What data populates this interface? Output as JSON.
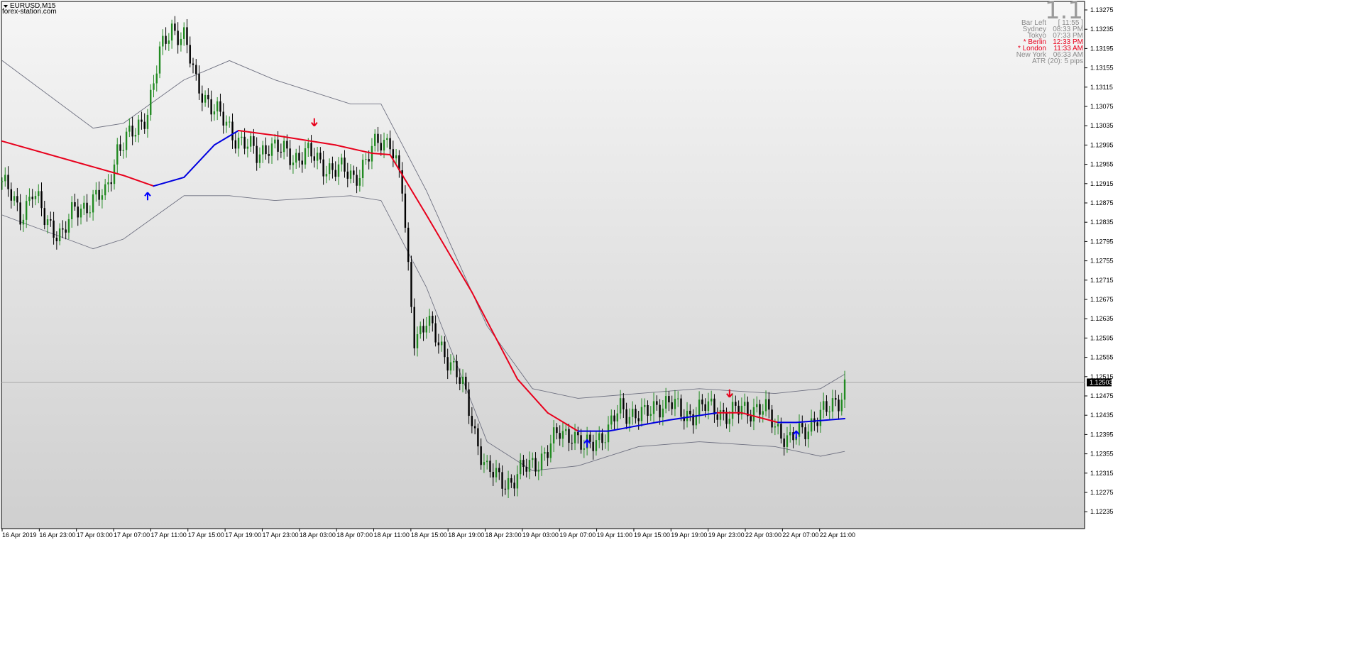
{
  "header": {
    "symbol": "EURUSD,M15",
    "website": "forex-station.com"
  },
  "info_panel": {
    "big_value": "1.1",
    "bar_left_label": "Bar Left",
    "bar_left_value": "[ 11:55 ]",
    "sessions": [
      {
        "label": "Sydney",
        "time": "08:33 PM",
        "active": false
      },
      {
        "label": "Tokyo",
        "time": "07:33 PM",
        "active": false
      },
      {
        "label": "* Berlin",
        "time": "12:33 PM",
        "active": true
      },
      {
        "label": "* London",
        "time": "11:33 AM",
        "active": true
      },
      {
        "label": "New York",
        "time": "06:33 AM",
        "active": false
      }
    ],
    "atr": "ATR (20): 5 pips"
  },
  "colors": {
    "up_candle": "#228b22",
    "down_candle": "#000000",
    "ma_down": "#e8001c",
    "ma_up": "#0000e0",
    "bands": "#6e7080",
    "arrow_up": "#0000ff",
    "arrow_down": "#e8001c",
    "price_label_bg": "#000000"
  },
  "chart_data": {
    "type": "candlestick",
    "symbol": "EURUSD",
    "timeframe": "M15",
    "y_ticks": [
      "1.13275",
      "1.13235",
      "1.13195",
      "1.13155",
      "1.13115",
      "1.13075",
      "1.13035",
      "1.12995",
      "1.12955",
      "1.12915",
      "1.12875",
      "1.12835",
      "1.12795",
      "1.12755",
      "1.12715",
      "1.12675",
      "1.12635",
      "1.12595",
      "1.12555",
      "1.12515",
      "1.12475",
      "1.12435",
      "1.12395",
      "1.12355",
      "1.12315",
      "1.12275",
      "1.12235"
    ],
    "ylim": [
      1.12225,
      1.13289
    ],
    "x_ticks": [
      "16 Apr 2019",
      "16 Apr 23:00",
      "17 Apr 03:00",
      "17 Apr 07:00",
      "17 Apr 11:00",
      "17 Apr 15:00",
      "17 Apr 19:00",
      "17 Apr 23:00",
      "18 Apr 03:00",
      "18 Apr 07:00",
      "18 Apr 11:00",
      "18 Apr 15:00",
      "18 Apr 19:00",
      "18 Apr 23:00",
      "19 Apr 03:00",
      "19 Apr 07:00",
      "19 Apr 11:00",
      "19 Apr 15:00",
      "19 Apr 19:00",
      "19 Apr 23:00",
      "22 Apr 03:00",
      "22 Apr 07:00",
      "22 Apr 11:00"
    ],
    "current_price": "1.12503",
    "price_path": [
      [
        0,
        1.1292
      ],
      [
        6,
        1.1285
      ],
      [
        10,
        1.129
      ],
      [
        14,
        1.1284
      ],
      [
        20,
        1.1281
      ],
      [
        24,
        1.1286
      ],
      [
        30,
        1.1288
      ],
      [
        34,
        1.1289
      ],
      [
        38,
        1.1299
      ],
      [
        44,
        1.1302
      ],
      [
        48,
        1.1307
      ],
      [
        52,
        1.1318
      ],
      [
        56,
        1.1324
      ],
      [
        60,
        1.1322
      ],
      [
        64,
        1.1312
      ],
      [
        68,
        1.1309
      ],
      [
        72,
        1.1305
      ],
      [
        76,
        1.1302
      ],
      [
        80,
        1.13
      ],
      [
        84,
        1.1297
      ],
      [
        88,
        1.13
      ],
      [
        92,
        1.1298
      ],
      [
        96,
        1.1297
      ],
      [
        100,
        1.1298
      ],
      [
        104,
        1.1296
      ],
      [
        108,
        1.1295
      ],
      [
        112,
        1.1294
      ],
      [
        116,
        1.1293
      ],
      [
        120,
        1.1296
      ],
      [
        124,
        1.13
      ],
      [
        128,
        1.1301
      ],
      [
        132,
        1.129
      ],
      [
        134,
        1.1273
      ],
      [
        136,
        1.126
      ],
      [
        140,
        1.1263
      ],
      [
        144,
        1.1258
      ],
      [
        148,
        1.1255
      ],
      [
        152,
        1.1249
      ],
      [
        156,
        1.124
      ],
      [
        160,
        1.1232
      ],
      [
        164,
        1.123
      ],
      [
        168,
        1.123
      ],
      [
        172,
        1.1232
      ],
      [
        176,
        1.1234
      ],
      [
        180,
        1.1236
      ],
      [
        184,
        1.124
      ],
      [
        188,
        1.124
      ],
      [
        192,
        1.1236
      ],
      [
        196,
        1.1239
      ],
      [
        200,
        1.124
      ],
      [
        204,
        1.1245
      ],
      [
        208,
        1.1244
      ],
      [
        212,
        1.1243
      ],
      [
        216,
        1.1246
      ],
      [
        220,
        1.1246
      ],
      [
        224,
        1.1244
      ],
      [
        228,
        1.1244
      ],
      [
        232,
        1.1245
      ],
      [
        236,
        1.1245
      ],
      [
        240,
        1.1243
      ],
      [
        244,
        1.1245
      ],
      [
        248,
        1.1245
      ],
      [
        252,
        1.1244
      ],
      [
        256,
        1.1241
      ],
      [
        260,
        1.1238
      ],
      [
        264,
        1.124
      ],
      [
        268,
        1.1243
      ],
      [
        272,
        1.1244
      ],
      [
        276,
        1.1247
      ],
      [
        278,
        1.125
      ]
    ],
    "ma_points": [
      [
        0,
        1.13003,
        "down"
      ],
      [
        40,
        1.12932,
        "down"
      ],
      [
        50,
        1.1291,
        "down"
      ],
      [
        60,
        1.12928,
        "up"
      ],
      [
        70,
        1.12995,
        "up"
      ],
      [
        78,
        1.13025,
        "up"
      ],
      [
        90,
        1.13015,
        "down"
      ],
      [
        110,
        1.12995,
        "down"
      ],
      [
        122,
        1.12978,
        "down"
      ],
      [
        128,
        1.12975,
        "down"
      ],
      [
        140,
        1.1285,
        "down"
      ],
      [
        155,
        1.1269,
        "down"
      ],
      [
        170,
        1.1251,
        "down"
      ],
      [
        180,
        1.1244,
        "down"
      ],
      [
        190,
        1.12402,
        "down"
      ],
      [
        200,
        1.12402,
        "up"
      ],
      [
        220,
        1.12425,
        "up"
      ],
      [
        236,
        1.1244,
        "up"
      ],
      [
        244,
        1.1244,
        "down"
      ],
      [
        256,
        1.1242,
        "down"
      ],
      [
        262,
        1.1242,
        "up"
      ],
      [
        278,
        1.12428,
        "up"
      ]
    ],
    "upper_band": [
      [
        0,
        1.1317
      ],
      [
        30,
        1.1303
      ],
      [
        40,
        1.1304
      ],
      [
        60,
        1.1313
      ],
      [
        75,
        1.1317
      ],
      [
        90,
        1.1313
      ],
      [
        115,
        1.1308
      ],
      [
        125,
        1.1308
      ],
      [
        140,
        1.129
      ],
      [
        160,
        1.1262
      ],
      [
        175,
        1.1249
      ],
      [
        190,
        1.1247
      ],
      [
        210,
        1.1248
      ],
      [
        230,
        1.1249
      ],
      [
        255,
        1.1248
      ],
      [
        270,
        1.1249
      ],
      [
        278,
        1.1252
      ]
    ],
    "lower_band": [
      [
        0,
        1.1285
      ],
      [
        30,
        1.1278
      ],
      [
        40,
        1.128
      ],
      [
        60,
        1.1289
      ],
      [
        75,
        1.1289
      ],
      [
        90,
        1.1288
      ],
      [
        115,
        1.1289
      ],
      [
        125,
        1.1288
      ],
      [
        140,
        1.127
      ],
      [
        160,
        1.1238
      ],
      [
        175,
        1.1232
      ],
      [
        190,
        1.1233
      ],
      [
        210,
        1.1237
      ],
      [
        230,
        1.1238
      ],
      [
        255,
        1.1237
      ],
      [
        270,
        1.1235
      ],
      [
        278,
        1.1236
      ]
    ],
    "signals": [
      {
        "type": "up",
        "bar": 48
      },
      {
        "type": "down",
        "bar": 103
      },
      {
        "type": "up",
        "bar": 193
      },
      {
        "type": "down",
        "bar": 240
      },
      {
        "type": "up",
        "bar": 262
      }
    ]
  }
}
